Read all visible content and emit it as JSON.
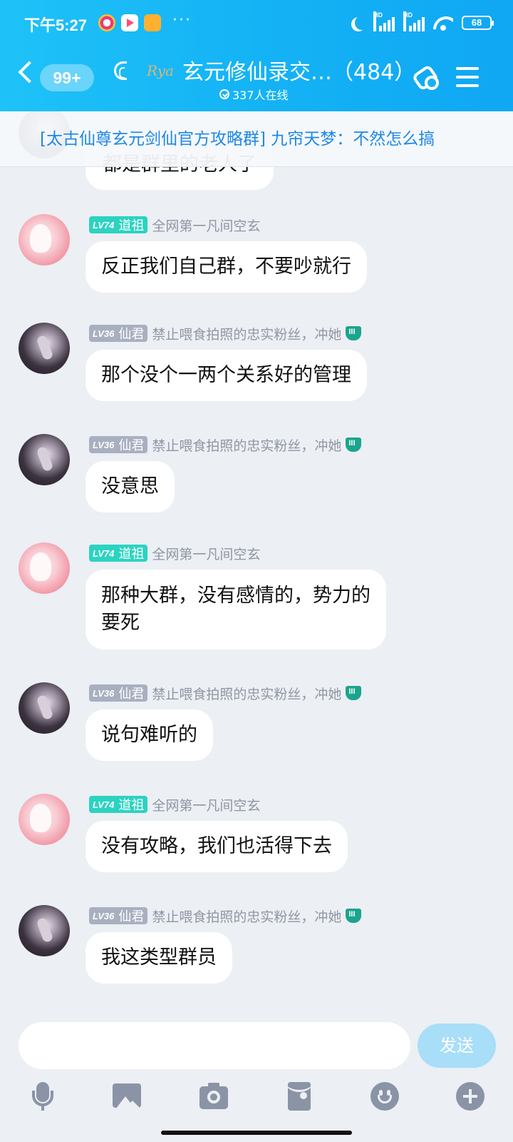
{
  "status_bar": {
    "time": "下午5:27",
    "dots": "···",
    "battery": "68"
  },
  "header": {
    "unread_count": "99+",
    "group_title": "玄元修仙录交…（484）",
    "online_text": "337人在线",
    "logo_text": "Rya"
  },
  "notice": {
    "text": "[太古仙尊玄元剑仙官方攻略群] 九帘天梦：不然怎么搞"
  },
  "partial_message": {
    "text": "都是群里的老人了"
  },
  "messages": [
    {
      "level": "LV74",
      "rank": "道祖",
      "nickname": "全网第一凡间空玄",
      "text_lines": [
        "反正我们自己群，不要吵就行"
      ]
    },
    {
      "level": "LV36",
      "rank": "仙君",
      "nickname": "禁止喂食拍照的忠实粉丝，冲她",
      "text_lines": [
        "那个没个一两个关系好的管理"
      ]
    },
    {
      "level": "LV36",
      "rank": "仙君",
      "nickname": "禁止喂食拍照的忠实粉丝，冲她",
      "text_lines": [
        "没意思"
      ]
    },
    {
      "level": "LV74",
      "rank": "道祖",
      "nickname": "全网第一凡间空玄",
      "text_lines": [
        "那种大群，没有感情的，势力的",
        "要死"
      ]
    },
    {
      "level": "LV36",
      "rank": "仙君",
      "nickname": "禁止喂食拍照的忠实粉丝，冲她",
      "text_lines": [
        "说句难听的"
      ]
    },
    {
      "level": "LV74",
      "rank": "道祖",
      "nickname": "全网第一凡间空玄",
      "text_lines": [
        "没有攻略，我们也活得下去"
      ]
    },
    {
      "level": "LV36",
      "rank": "仙君",
      "nickname": "禁止喂食拍照的忠实粉丝，冲她",
      "text_lines": [
        "我这类型群员"
      ]
    }
  ],
  "input": {
    "placeholder": "",
    "send_label": "发送"
  },
  "icons": [
    "mic-icon",
    "image-icon",
    "camera-icon",
    "red-packet-icon",
    "emoji-icon",
    "plus-icon"
  ],
  "colors": {
    "header_accent": "#14b3f5",
    "notice_text": "#1e88e5",
    "lv_teal": "#2bd3c1",
    "lv_gray": "#a8b0c0",
    "send_button": "#a8def8"
  }
}
